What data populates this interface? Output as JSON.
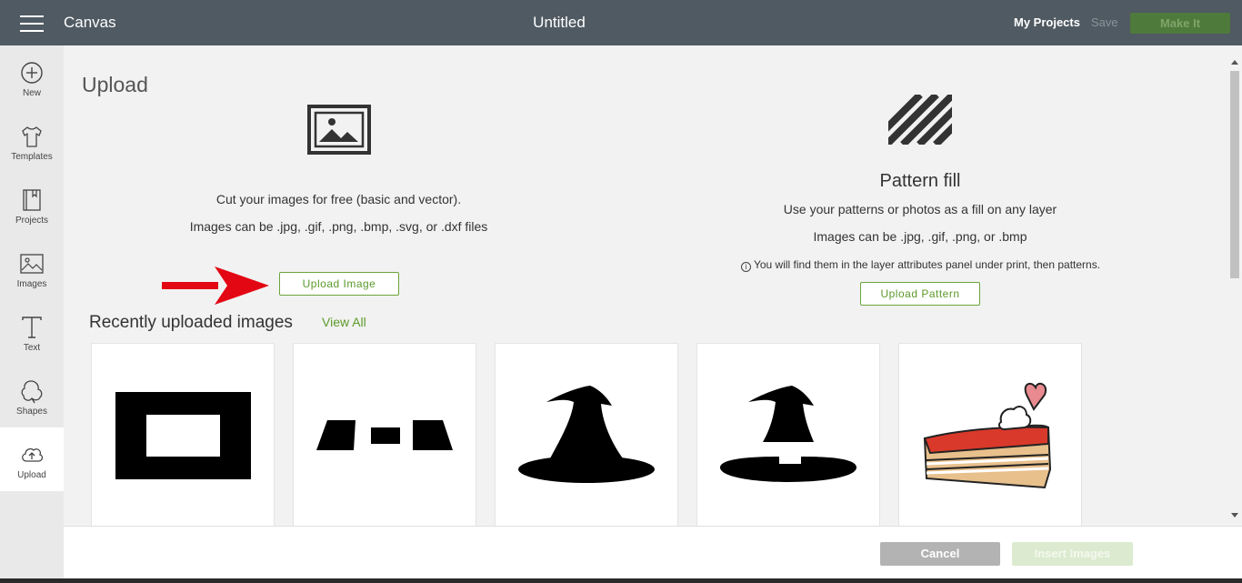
{
  "topbar": {
    "app_title": "Canvas",
    "doc_title": "Untitled",
    "my_projects": "My Projects",
    "save": "Save",
    "make_it": "Make It"
  },
  "sidebar": {
    "items": [
      {
        "label": "New",
        "icon": "plus-circle-icon"
      },
      {
        "label": "Templates",
        "icon": "tshirt-icon"
      },
      {
        "label": "Projects",
        "icon": "projects-icon"
      },
      {
        "label": "Images",
        "icon": "image-icon"
      },
      {
        "label": "Text",
        "icon": "text-icon"
      },
      {
        "label": "Shapes",
        "icon": "shapes-icon"
      },
      {
        "label": "Upload",
        "icon": "upload-cloud-icon",
        "active": true
      }
    ]
  },
  "upload": {
    "title": "Upload",
    "cut_text": "Cut your images for free (basic and vector).",
    "formats": "Images can be .jpg, .gif, .png, .bmp, .svg, or .dxf files",
    "button": "Upload Image"
  },
  "pattern": {
    "title": "Pattern fill",
    "description": "Use your patterns or photos as a fill on any layer",
    "formats": "Images can be .jpg, .gif, .png, or .bmp",
    "note": "You will find them in the layer attributes panel under print, then patterns.",
    "button": "Upload Pattern"
  },
  "recent": {
    "title": "Recently uploaded images",
    "view_all": "View All",
    "tiles": [
      "frame-image",
      "shapes-image",
      "witch-hat-image",
      "witch-hat-cut-image",
      "cake-slice-image"
    ]
  },
  "footer": {
    "cancel": "Cancel",
    "insert": "Insert Images"
  },
  "colors": {
    "topbar": "#505a62",
    "accent_green": "#5c9a2c",
    "make_it_bg": "#4e7a3b",
    "arrow_red": "#e30613"
  }
}
